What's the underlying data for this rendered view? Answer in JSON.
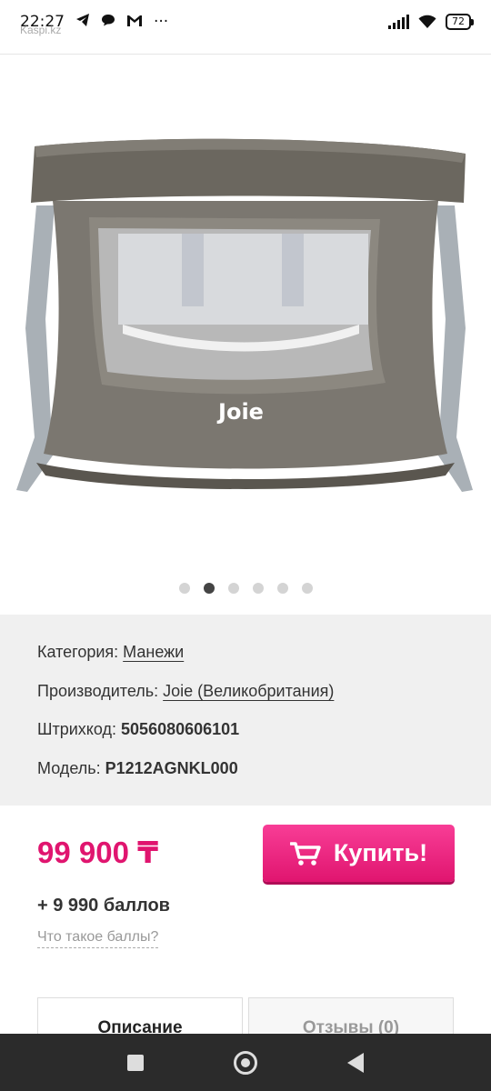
{
  "status_bar": {
    "time": "22:27",
    "overlay_tag": "Kaspi.kz",
    "battery": "72"
  },
  "product": {
    "brand_logo_text": "Joie",
    "gallery": {
      "total": 6,
      "active_index": 1
    }
  },
  "info": {
    "category_label": "Категория:",
    "category_value": "Манежи",
    "manufacturer_label": "Производитель:",
    "manufacturer_value": "Joie (Великобритания)",
    "barcode_label": "Штрихкод:",
    "barcode_value": "5056080606101",
    "model_label": "Модель:",
    "model_value": "P1212AGNKL000"
  },
  "purchase": {
    "price": "99 900 ₸",
    "buy_label": "Купить!",
    "bonus": "+ 9 990 баллов",
    "bonus_help": "Что такое баллы?"
  },
  "tabs": [
    {
      "label": "Описание"
    },
    {
      "label": "Отзывы (0)"
    }
  ],
  "colors": {
    "accent": "#e0156f",
    "panel_bg": "#f0f0f0",
    "nav_bg": "#2b2b2b"
  },
  "icons": [
    "telegram-icon",
    "chat-icon",
    "gmail-icon",
    "signal-icon",
    "wifi-icon",
    "battery-icon",
    "cart-icon",
    "nav-recents-icon",
    "nav-home-icon",
    "nav-back-icon"
  ]
}
